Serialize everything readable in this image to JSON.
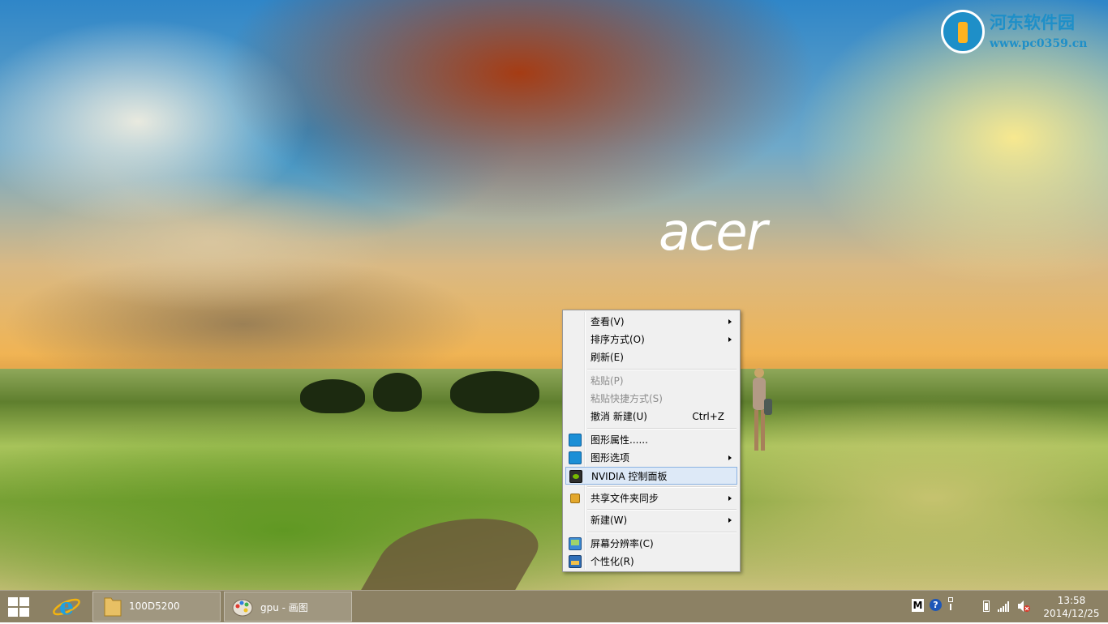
{
  "desktop": {
    "logo_text": "acer",
    "watermark": {
      "site_name": "河东软件园",
      "url": "www.pc0359.cn"
    }
  },
  "context_menu": {
    "items": [
      {
        "label": "查看(V)",
        "submenu": true
      },
      {
        "label": "排序方式(O)",
        "submenu": true
      },
      {
        "label": "刷新(E)"
      },
      {
        "label": "粘贴(P)",
        "disabled": true
      },
      {
        "label": "粘贴快捷方式(S)",
        "disabled": true
      },
      {
        "label": "撤消 新建(U)",
        "shortcut": "Ctrl+Z"
      },
      {
        "label": "图形属性......",
        "icon": "intel-graphics-icon"
      },
      {
        "label": "图形选项",
        "icon": "intel-graphics-icon",
        "submenu": true
      },
      {
        "label": "NVIDIA 控制面板",
        "icon": "nvidia-icon",
        "highlighted": true
      },
      {
        "label": "共享文件夹同步",
        "icon": "sync-folder-icon",
        "submenu": true
      },
      {
        "label": "新建(W)",
        "submenu": true
      },
      {
        "label": "屏幕分辨率(C)",
        "icon": "screen-resolution-icon"
      },
      {
        "label": "个性化(R)",
        "icon": "personalize-icon"
      }
    ]
  },
  "taskbar": {
    "buttons": [
      {
        "label": "100D5200",
        "icon": "folder-icon"
      },
      {
        "label": "gpu - 画图",
        "icon": "paint-icon"
      }
    ],
    "tray": {
      "ime_label": "M",
      "icons": [
        "help-icon",
        "pen-icon",
        "battery-icon",
        "signal-icon",
        "volume-muted-icon"
      ]
    },
    "clock": {
      "time": "13:58",
      "date": "2014/12/25"
    }
  },
  "colors": {
    "menu_bg": "#f0f0f0",
    "menu_highlight": "#dde9f7",
    "menu_highlight_border": "#8cb3e2",
    "taskbar": "#5f5028",
    "watermark": "#1e8fc8"
  }
}
